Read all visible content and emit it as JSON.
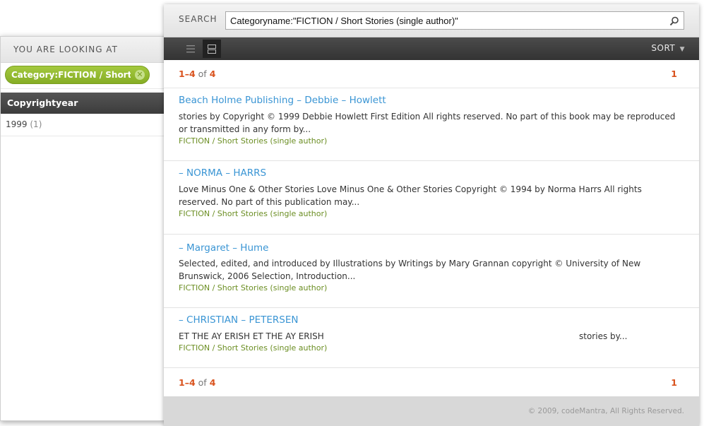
{
  "facets": {
    "header": "YOU ARE LOOKING AT",
    "active_filter": "Category:FICTION / Short",
    "group_title": "Copyrightyear",
    "items": [
      {
        "label": "1999",
        "count": "(1)"
      }
    ]
  },
  "search": {
    "label": "SEARCH",
    "query": "Categoryname:\"FICTION / Short Stories (single author)\""
  },
  "toolbar": {
    "sort_label": "SORT"
  },
  "pager": {
    "range": "1–4",
    "of": "of",
    "total": "4",
    "page": "1"
  },
  "results": [
    {
      "title": "Beach Holme Publishing – Debbie – Howlett",
      "snippet": "stories by Copyright © 1999 Debbie Howlett First Edition All rights reserved. No part of this book may be reproduced or transmitted in any form by...",
      "category": "FICTION / Short Stories (single author)"
    },
    {
      "title": "– NORMA – HARRS",
      "snippet": "Love Minus One & Other Stories Love Minus One & Other Stories Copyright © 1994 by Norma Harrs All rights reserved. No part of this publication may...",
      "category": "FICTION / Short Stories (single author)"
    },
    {
      "title": "– Margaret – Hume",
      "snippet": "Selected, edited, and introduced by Illustrations by Writings by Mary Grannan copyright © University of New Brunswick, 2006 Selection, Introduction...",
      "category": "FICTION / Short Stories (single author)"
    },
    {
      "title": "– CHRISTIAN – PETERSEN",
      "snippet_left": "ET THE AY ERISH ET THE AY ERISH",
      "snippet_right": "stories by...",
      "category": "FICTION / Short Stories (single author)"
    }
  ],
  "footer": {
    "copyright": "© 2009, codeMantra, All Rights Reserved."
  },
  "colors": {
    "accent_orange": "#d9531e",
    "link_blue": "#3a95d4",
    "chip_green": "#8db52c",
    "category_green": "#6b8e23"
  },
  "icons": {
    "search": "search-icon",
    "list_view": "list-view-icon",
    "detail_view": "detail-view-icon",
    "chip_remove": "close-circle-icon"
  }
}
